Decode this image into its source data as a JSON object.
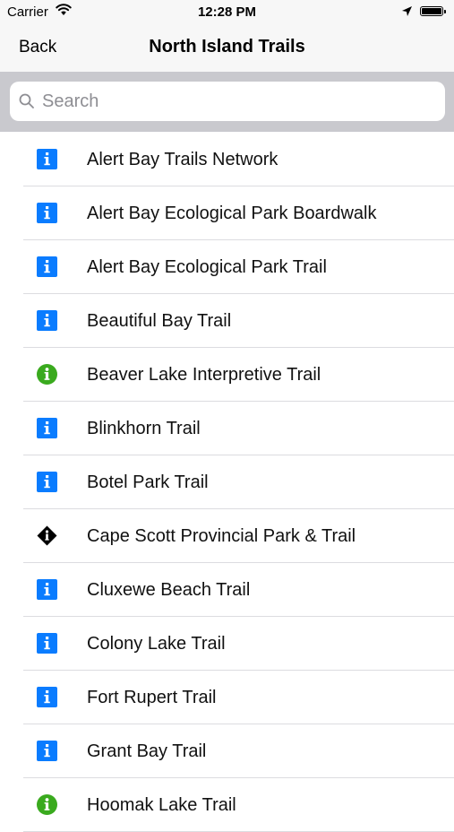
{
  "status_bar": {
    "carrier": "Carrier",
    "time": "12:28 PM"
  },
  "nav": {
    "back_label": "Back",
    "title": "North Island Trails"
  },
  "search": {
    "placeholder": "Search",
    "value": ""
  },
  "colors": {
    "info_blue": "#0a7cff",
    "interpretive_green": "#3aaa1e",
    "diamond_black": "#000000",
    "bar_gray": "#c9c9ce"
  },
  "trails": [
    {
      "label": "Alert Bay Trails Network",
      "icon": "info-square-icon"
    },
    {
      "label": "Alert Bay Ecological Park Boardwalk",
      "icon": "info-square-icon"
    },
    {
      "label": "Alert Bay Ecological Park Trail",
      "icon": "info-square-icon"
    },
    {
      "label": "Beautiful Bay Trail",
      "icon": "info-square-icon"
    },
    {
      "label": "Beaver Lake Interpretive Trail",
      "icon": "info-circle-icon"
    },
    {
      "label": "Blinkhorn Trail",
      "icon": "info-square-icon"
    },
    {
      "label": "Botel Park Trail",
      "icon": "info-square-icon"
    },
    {
      "label": "Cape Scott Provincial Park & Trail",
      "icon": "black-diamond-icon"
    },
    {
      "label": "Cluxewe Beach Trail",
      "icon": "info-square-icon"
    },
    {
      "label": "Colony Lake Trail",
      "icon": "info-square-icon"
    },
    {
      "label": "Fort Rupert Trail",
      "icon": "info-square-icon"
    },
    {
      "label": "Grant Bay Trail",
      "icon": "info-square-icon"
    },
    {
      "label": "Hoomak Lake Trail",
      "icon": "info-circle-icon"
    }
  ]
}
